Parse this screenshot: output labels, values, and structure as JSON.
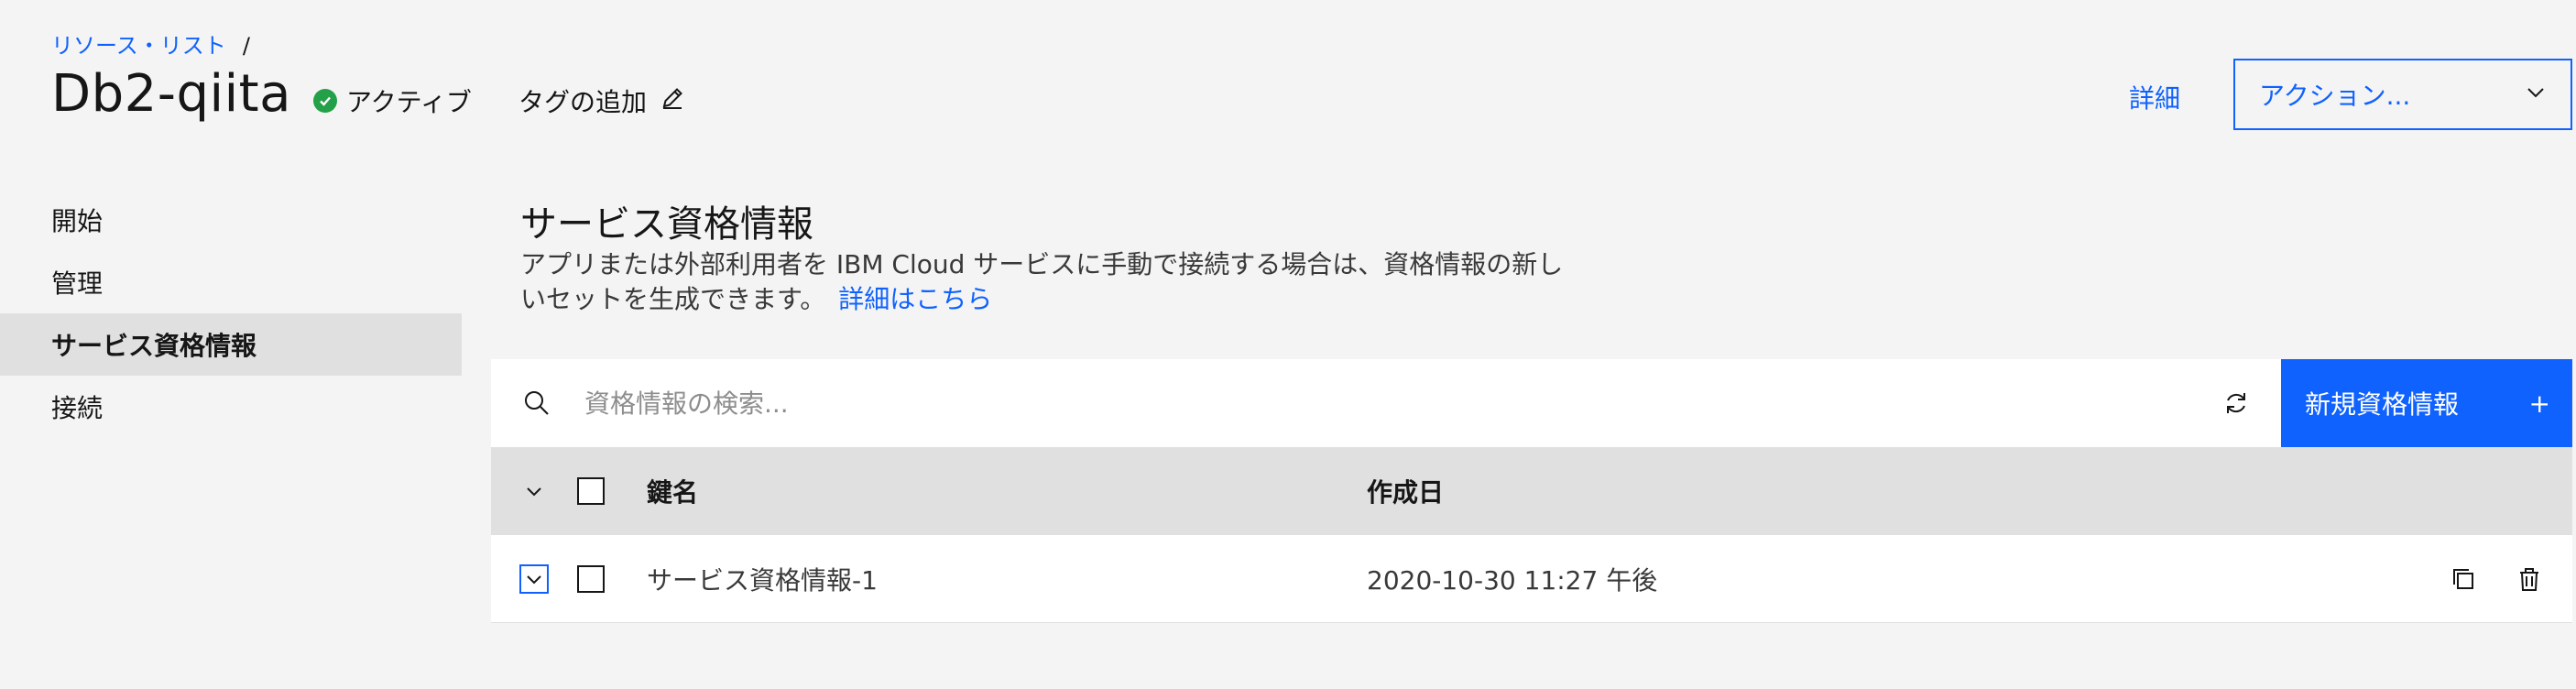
{
  "breadcrumb": {
    "link": "リソース・リスト",
    "separator": "/"
  },
  "header": {
    "title": "Db2-qiita",
    "status": "アクティブ",
    "add_tag": "タグの追加",
    "details": "詳細",
    "actions": "アクション..."
  },
  "sidebar": {
    "items": [
      {
        "label": "開始"
      },
      {
        "label": "管理"
      },
      {
        "label": "サービス資格情報"
      },
      {
        "label": "接続"
      }
    ]
  },
  "section": {
    "title": "サービス資格情報",
    "description": "アプリまたは外部利用者を IBM Cloud サービスに手動で接続する場合は、資格情報の新しいセットを生成できます。",
    "learn_more": "詳細はこちら"
  },
  "toolbar": {
    "search_placeholder": "資格情報の検索...",
    "new_credential": "新規資格情報",
    "plus": "+"
  },
  "table": {
    "headers": {
      "key_name": "鍵名",
      "created": "作成日"
    },
    "rows": [
      {
        "name": "サービス資格情報-1",
        "date": "2020-10-30 11:27 午後"
      }
    ]
  },
  "colors": {
    "accent": "#0f62fe",
    "status_green": "#24a148",
    "background": "#f4f4f4"
  }
}
